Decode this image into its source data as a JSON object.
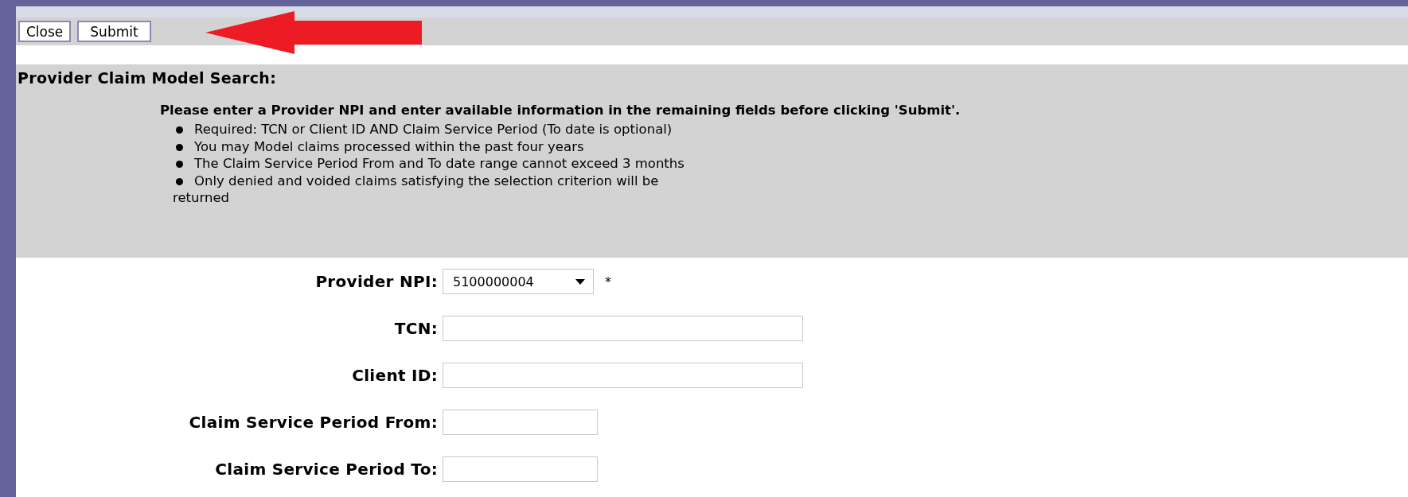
{
  "toolbar": {
    "buttons": [
      {
        "label": "Close"
      },
      {
        "label": "Submit"
      }
    ]
  },
  "section": {
    "title": "Provider Claim Model Search:",
    "instruction": "Please enter a Provider NPI and enter available information in the remaining fields before clicking 'Submit'.",
    "bullets": [
      "Required: TCN or Client ID AND Claim Service Period (To date is optional)",
      "You may Model claims processed within the past four years",
      "The Claim Service Period From and To date range cannot exceed 3 months",
      "Only denied and voided claims satisfying the selection criterion will be"
    ],
    "bullet_continuation": "returned"
  },
  "fields": [
    {
      "kind": "select",
      "label": "Provider NPI:",
      "value": "5100000004",
      "required_mark": "*"
    },
    {
      "kind": "text",
      "label": "TCN:"
    },
    {
      "kind": "text",
      "label": "Client ID:"
    },
    {
      "kind": "date",
      "label": "Claim Service Period From:"
    },
    {
      "kind": "date",
      "label": "Claim Service Period To:"
    }
  ]
}
